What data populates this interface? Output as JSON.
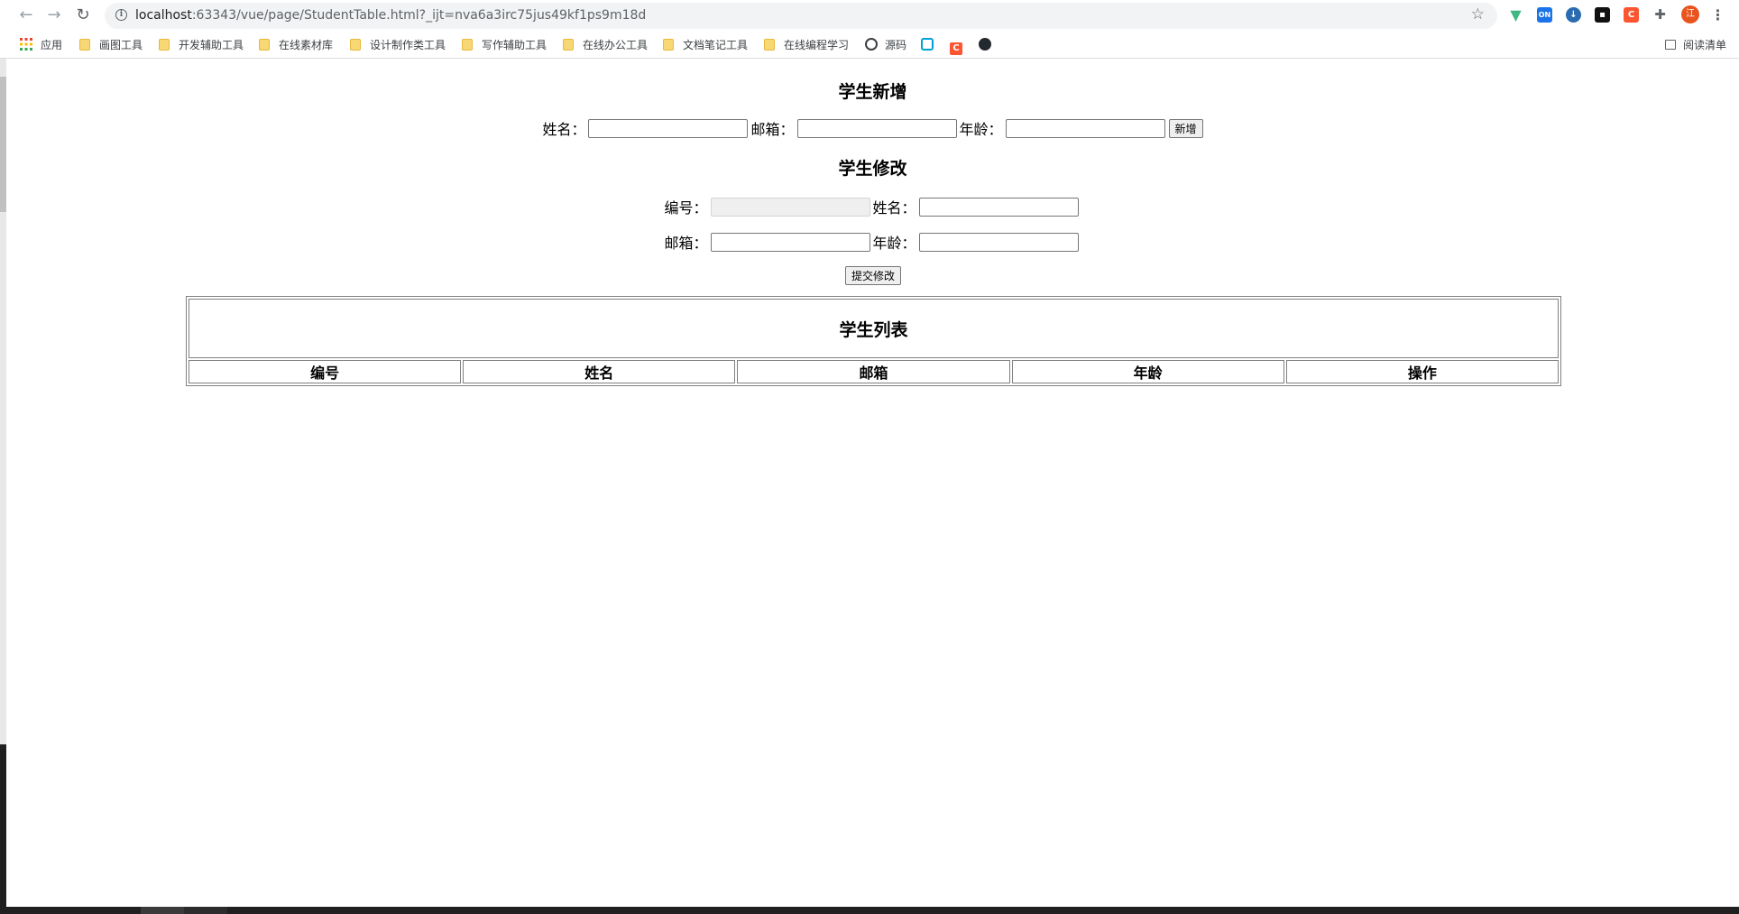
{
  "browser": {
    "url_host": "localhost",
    "url_rest": ":63343/vue/page/StudentTable.html?_ijt=nva6a3irc75jus49kf1ps9m18d",
    "bookmarks": [
      {
        "label": "应用",
        "icon": "apps-icon"
      },
      {
        "label": "画图工具",
        "icon": "folder-icon"
      },
      {
        "label": "开发辅助工具",
        "icon": "folder-icon"
      },
      {
        "label": "在线素材库",
        "icon": "folder-icon"
      },
      {
        "label": "设计制作类工具",
        "icon": "folder-icon"
      },
      {
        "label": "写作辅助工具",
        "icon": "folder-icon"
      },
      {
        "label": "在线办公工具",
        "icon": "folder-icon"
      },
      {
        "label": "文档笔记工具",
        "icon": "folder-icon"
      },
      {
        "label": "在线编程学习",
        "icon": "folder-icon"
      },
      {
        "label": "源码",
        "icon": "globe-icon"
      }
    ],
    "reading_list": "阅读清单",
    "profile_initial": "江"
  },
  "add_form": {
    "title": "学生新增",
    "name_label": "姓名：",
    "email_label": "邮箱：",
    "age_label": "年龄：",
    "name_value": "",
    "email_value": "",
    "age_value": "",
    "submit_label": "新增"
  },
  "edit_form": {
    "title": "学生修改",
    "id_label": "编号：",
    "name_label": "姓名：",
    "email_label": "邮箱：",
    "age_label": "年龄：",
    "id_value": "",
    "name_value": "",
    "email_value": "",
    "age_value": "",
    "submit_label": "提交修改"
  },
  "table": {
    "title": "学生列表",
    "headers": [
      "编号",
      "姓名",
      "邮箱",
      "年龄",
      "操作"
    ],
    "rows": []
  }
}
